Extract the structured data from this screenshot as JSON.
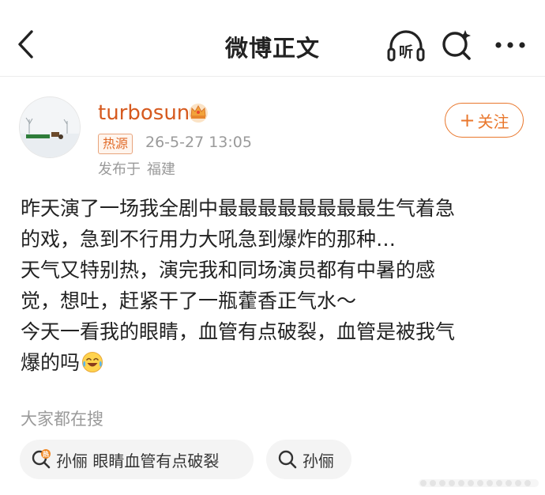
{
  "nav": {
    "title": "微博正文",
    "listen_glyph": "听"
  },
  "post": {
    "username": "turbosun",
    "badge": "热源",
    "time": "26-5-27 13:05",
    "from_label": "发布于",
    "location": "福建",
    "follow_label": "关注",
    "follow_plus": "+",
    "lines": [
      "昨天演了一场我全剧中最最最最最最最最生气着急",
      "的戏，急到不行用力大吼急到爆炸的那种…",
      "天气又特别热，演完我和同场演员都有中暑的感",
      "觉，想吐，赶紧干了一瓶藿香正气水～",
      "今天一看我的眼睛，血管有点破裂，血管是被我气",
      "爆的吗"
    ],
    "emoji": "laughing-crying-emoji"
  },
  "search": {
    "label": "大家都在搜",
    "chips": [
      {
        "text": "孙俪 眼睛血管有点破裂",
        "icon": "hot-search-icon",
        "icon_glyph": "热"
      },
      {
        "text": "孙俪",
        "icon": "search-icon"
      }
    ]
  },
  "colors": {
    "accent": "#e9772c",
    "username": "#d65a1f",
    "muted": "#9a9a9a",
    "chip_bg": "#f4f4f4"
  }
}
